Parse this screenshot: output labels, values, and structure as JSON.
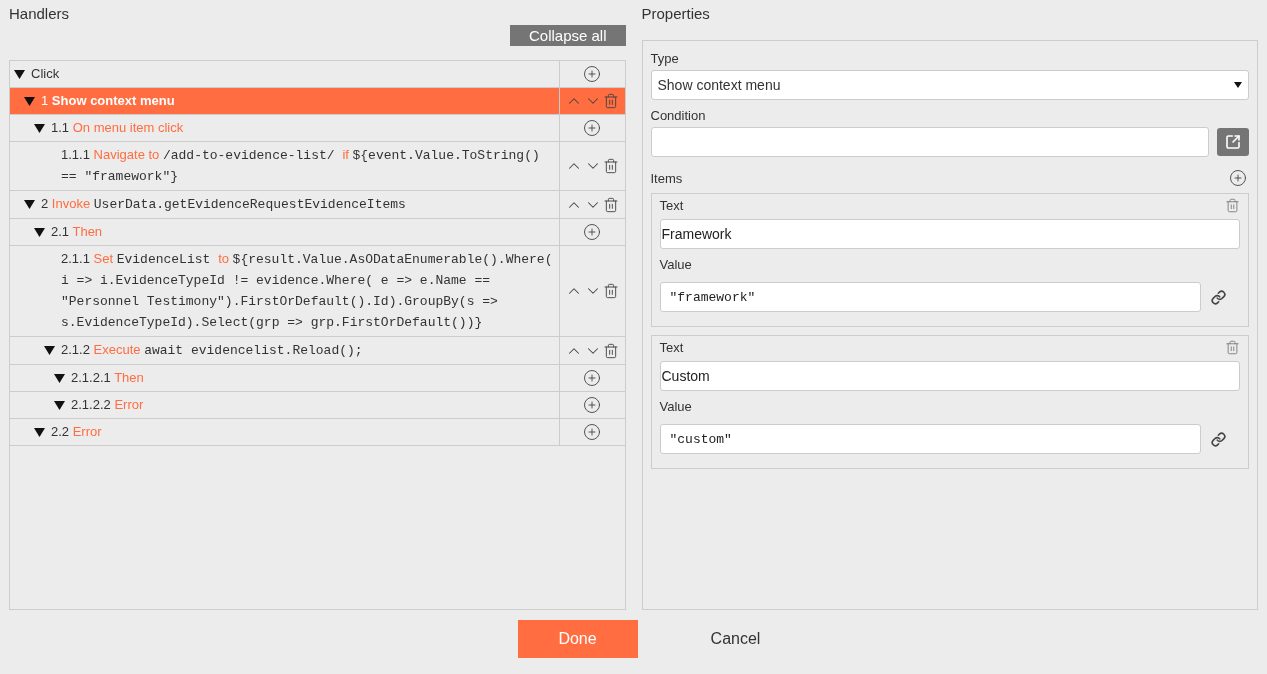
{
  "handlers": {
    "title": "Handlers",
    "collapse_button": "Collapse all",
    "tree": [
      {
        "kind": "branch",
        "expanded": true,
        "selected": false,
        "reorderable": false,
        "parts": [
          {
            "kind": "plain",
            "text": "Click"
          }
        ],
        "children": [
          {
            "kind": "branch",
            "expanded": true,
            "selected": true,
            "number": "1",
            "reorderable": true,
            "parts": [
              {
                "kind": "keyword",
                "text": "Show context menu"
              }
            ],
            "children": [
              {
                "kind": "branch",
                "expanded": true,
                "selected": false,
                "number": "1.1",
                "reorderable": false,
                "parts": [
                  {
                    "kind": "keyword",
                    "text": "On menu item click"
                  }
                ],
                "children": [
                  {
                    "kind": "leaf",
                    "selected": false,
                    "number": "1.1.1",
                    "reorderable": true,
                    "parts": [
                      {
                        "kind": "keyword",
                        "text": "Navigate to"
                      },
                      {
                        "kind": "code",
                        "text": "/add-to-evidence-list/"
                      },
                      {
                        "kind": "keyword",
                        "text": "if"
                      },
                      {
                        "kind": "code",
                        "text": "${event.Value.ToString() == \"framework\"}"
                      }
                    ]
                  }
                ]
              }
            ]
          },
          {
            "kind": "branch",
            "expanded": true,
            "selected": false,
            "number": "2",
            "reorderable": true,
            "parts": [
              {
                "kind": "keyword",
                "text": "Invoke"
              },
              {
                "kind": "code",
                "text": "UserData.getEvidenceRequestEvidenceItems"
              }
            ],
            "children": [
              {
                "kind": "branch",
                "expanded": true,
                "selected": false,
                "number": "2.1",
                "reorderable": false,
                "parts": [
                  {
                    "kind": "keyword",
                    "text": "Then"
                  }
                ],
                "children": [
                  {
                    "kind": "leaf",
                    "selected": false,
                    "number": "2.1.1",
                    "reorderable": true,
                    "parts": [
                      {
                        "kind": "keyword",
                        "text": "Set"
                      },
                      {
                        "kind": "code",
                        "text": "EvidenceList"
                      },
                      {
                        "kind": "keyword",
                        "text": "to"
                      },
                      {
                        "kind": "code",
                        "text": "${result.Value.AsODataEnumerable().Where( i => i.EvidenceTypeId != evidence.Where( e => e.Name == \"Personnel Testimony\").FirstOrDefault().Id).GroupBy(s => s.EvidenceTypeId).Select(grp => grp.FirstOrDefault())}"
                      }
                    ]
                  },
                  {
                    "kind": "branch",
                    "expanded": true,
                    "selected": false,
                    "number": "2.1.2",
                    "reorderable": true,
                    "parts": [
                      {
                        "kind": "keyword",
                        "text": "Execute"
                      },
                      {
                        "kind": "code",
                        "text": "await evidencelist.Reload();"
                      }
                    ],
                    "children": [
                      {
                        "kind": "branch",
                        "expanded": true,
                        "selected": false,
                        "number": "2.1.2.1",
                        "reorderable": false,
                        "parts": [
                          {
                            "kind": "keyword",
                            "text": "Then"
                          }
                        ]
                      },
                      {
                        "kind": "branch",
                        "expanded": true,
                        "selected": false,
                        "number": "2.1.2.2",
                        "reorderable": false,
                        "parts": [
                          {
                            "kind": "keyword",
                            "text": "Error"
                          }
                        ]
                      }
                    ]
                  }
                ]
              },
              {
                "kind": "branch",
                "expanded": true,
                "selected": false,
                "number": "2.2",
                "reorderable": false,
                "parts": [
                  {
                    "kind": "keyword",
                    "text": "Error"
                  }
                ]
              }
            ]
          }
        ]
      }
    ]
  },
  "properties": {
    "title": "Properties",
    "type_label": "Type",
    "type_value": "Show context menu",
    "condition_label": "Condition",
    "items_label": "Items",
    "items": [
      {
        "text_label": "Text",
        "text": "Framework",
        "value_label": "Value",
        "value": "\"framework\""
      },
      {
        "text_label": "Text",
        "text": "Custom",
        "value_label": "Value",
        "value": "\"custom\""
      }
    ]
  },
  "buttons": [
    {
      "kind": "primary",
      "label": "Done"
    },
    {
      "kind": "secondary",
      "label": "Cancel"
    }
  ]
}
